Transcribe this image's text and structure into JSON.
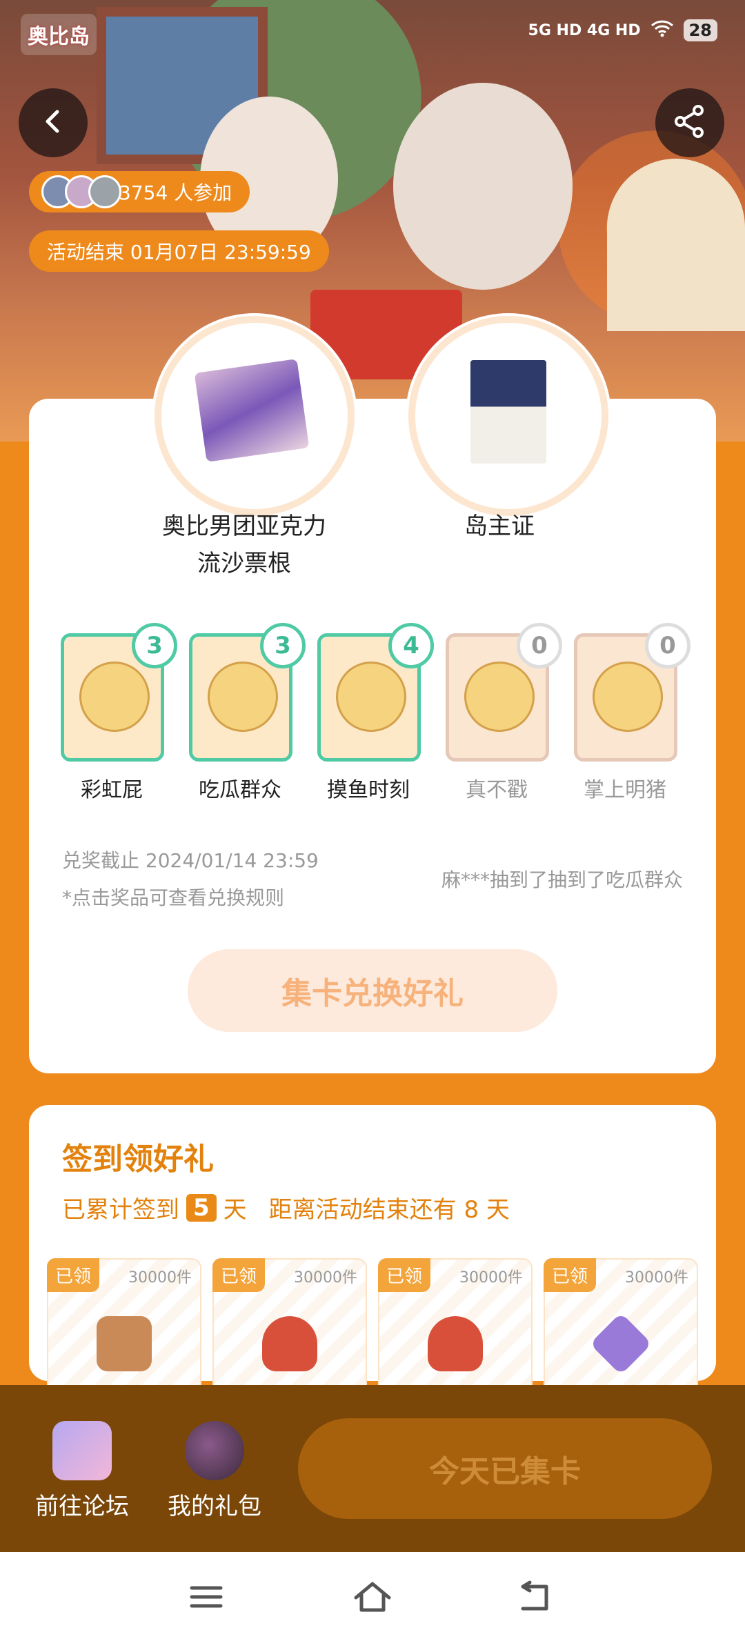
{
  "status_bar": {
    "network": "5G HD 4G HD",
    "battery": "28"
  },
  "header": {
    "logo_text": "奥比岛",
    "participants": "3754 人参加",
    "end_time": "活动结束 01月07日 23:59:59"
  },
  "prizes": [
    {
      "name": "奥比男团亚克力流沙票根",
      "line1": "奥比男团亚克力",
      "line2": "流沙票根"
    },
    {
      "name": "岛主证",
      "line1": "岛主证",
      "line2": ""
    }
  ],
  "collect_cards": [
    {
      "label": "彩虹屁",
      "count": "3",
      "collected": true
    },
    {
      "label": "吃瓜群众",
      "count": "3",
      "collected": true
    },
    {
      "label": "摸鱼时刻",
      "count": "4",
      "collected": true
    },
    {
      "label": "真不戳",
      "count": "0",
      "collected": false
    },
    {
      "label": "掌上明猪",
      "count": "0",
      "collected": false
    }
  ],
  "notes": {
    "deadline": "兑奖截止 2024/01/14 23:59",
    "hint": "*点击奖品可查看兑换规则",
    "ticker": "麻***抽到了抽到了吃瓜群众"
  },
  "exchange_button": "集卡兑换好礼",
  "signin": {
    "title": "签到领好礼",
    "prefix": "已累计签到",
    "days": "5",
    "unit": "天",
    "remaining": "距离活动结束还有 8 天",
    "rewards": [
      {
        "tag": "已领",
        "count": "30000件",
        "color": "#c98a58"
      },
      {
        "tag": "已领",
        "count": "30000件",
        "color": "#d9503a"
      },
      {
        "tag": "已领",
        "count": "30000件",
        "color": "#d9503a"
      },
      {
        "tag": "已领",
        "count": "30000件",
        "color": "#9a7ad8"
      }
    ]
  },
  "bottom_bar": {
    "forum": "前往论坛",
    "gifts": "我的礼包",
    "collect": "今天已集卡"
  },
  "colors": {
    "accent": "#ee8a1c",
    "mint": "#4fcaa5"
  }
}
